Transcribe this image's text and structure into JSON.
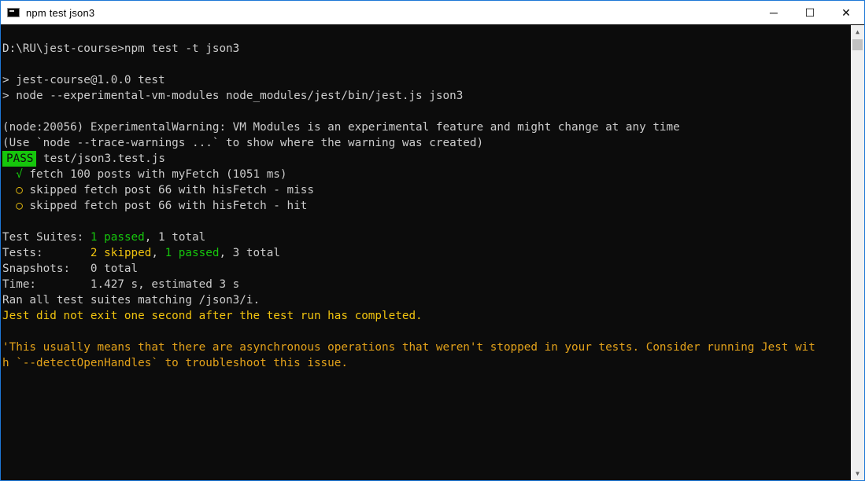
{
  "window": {
    "title": "npm test json3",
    "controls": {
      "minimize": "─",
      "maximize": "☐",
      "close": "✕"
    },
    "border_color": "#1e78d6"
  },
  "colors": {
    "background": "#0c0c0c",
    "text": "#cccccc",
    "green": "#16c60c",
    "yellow": "#f1c40f",
    "orange": "#e3a21a"
  },
  "terminal": {
    "prompt_line": "D:\\RU\\jest-course>npm test -t json3",
    "script_header": "> jest-course@1.0.0 test",
    "script_cmd": "> node --experimental-vm-modules node_modules/jest/bin/jest.js json3",
    "warning_1": "(node:20056) ExperimentalWarning: VM Modules is an experimental feature and might change at any time",
    "warning_2": "(Use `node --trace-warnings ...` to show where the warning was created)",
    "pass_badge": "PASS",
    "test_file": " test/json3.test.js",
    "tests": [
      {
        "mark": "√",
        "text": "fetch 100 posts with myFetch (1051 ms)"
      },
      {
        "mark": "○",
        "text": "skipped fetch post 66 with hisFetch - miss"
      },
      {
        "mark": "○",
        "text": "skipped fetch post 66 with hisFetch - hit"
      }
    ],
    "summary": {
      "suites_label": "Test Suites: ",
      "suites_passed": "1 passed",
      "suites_total": ", 1 total",
      "tests_label": "Tests:       ",
      "tests_skipped": "2 skipped",
      "tests_sep": ", ",
      "tests_passed": "1 passed",
      "tests_total": ", 3 total",
      "snapshots": "Snapshots:   0 total",
      "time": "Time:        1.427 s, estimated 3 s",
      "ran_all": "Ran all test suites matching /json3/i."
    },
    "jest_exit_msg": "Jest did not exit one second after the test run has completed.",
    "hint_line_1": "'This usually means that there are asynchronous operations that weren't stopped in your tests. Consider running Jest wit",
    "hint_line_2": "h `--detectOpenHandles` to troubleshoot this issue."
  }
}
